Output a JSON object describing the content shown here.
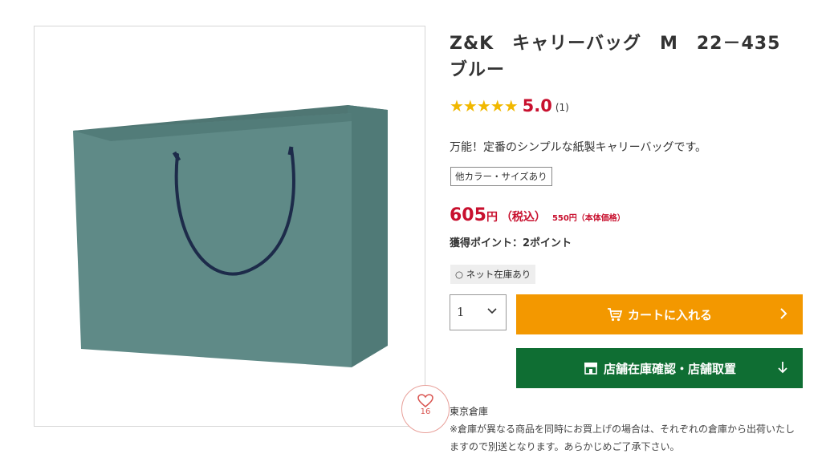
{
  "product": {
    "title": "Z&K　キャリーバッグ　M　22－435　ブルー",
    "rating": {
      "stars": "★★★★★",
      "value": "5.0",
      "count": "(1)",
      "star_color": "#f1b800"
    },
    "tagline": "万能！定番のシンプルな紙製キャリーバッグです。",
    "variants_badge": "他カラー・サイズあり",
    "price": {
      "amount": "605",
      "yen": "円",
      "tax_label": "（税込）",
      "base": "550円（本体価格）",
      "color": "#c8102e"
    },
    "points": "獲得ポイント：2ポイント",
    "stock_badge": "○ ネット在庫あり",
    "favorite": {
      "icon": "heart-icon",
      "count": "16"
    },
    "image": {
      "bag_color": "#5f8a87",
      "handle_color": "#1d2b4a"
    }
  },
  "purchase": {
    "quantity": "1",
    "cart_button": {
      "label": "カートに入れる",
      "icon": "cart-icon",
      "color": "#f39800"
    },
    "store_button": {
      "label": "店舗在庫確認・店舗取置",
      "icon": "store-icon",
      "color": "#0f6e33"
    }
  },
  "shipping": {
    "warehouse": "東京倉庫",
    "note": "※倉庫が異なる商品を同時にお買上げの場合は、それぞれの倉庫から出荷いたしますので別送となります。あらかじめご了承下さい。"
  }
}
